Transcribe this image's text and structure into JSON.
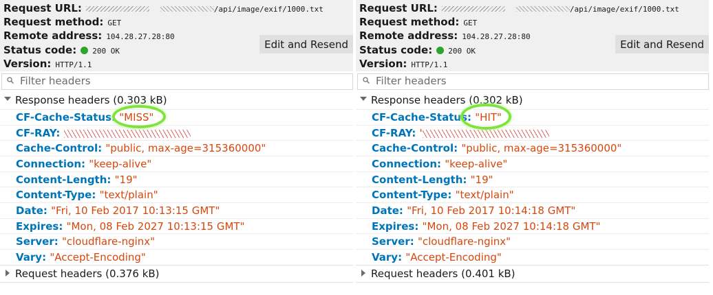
{
  "panels": [
    {
      "summary": {
        "url_label": "Request URL:",
        "url_value": "/api/image/exif/1000.txt",
        "method_label": "Request method:",
        "method_value": "GET",
        "remote_label": "Remote address:",
        "remote_value": "104.28.27.28:80",
        "status_label": "Status code:",
        "status_value": "200 OK",
        "version_label": "Version:",
        "version_value": "HTTP/1.1",
        "resend_label": "Edit and Resend"
      },
      "filter_placeholder": "Filter headers",
      "response_group": "Response headers (0.303 kB)",
      "headers": [
        {
          "name": "CF-Cache-Status",
          "value": "\"MISS\""
        },
        {
          "name": "CF-RAY",
          "value": ""
        },
        {
          "name": "Cache-Control",
          "value": "\"public, max-age=315360000\""
        },
        {
          "name": "Connection",
          "value": "\"keep-alive\""
        },
        {
          "name": "Content-Length",
          "value": "\"19\""
        },
        {
          "name": "Content-Type",
          "value": "\"text/plain\""
        },
        {
          "name": "Date",
          "value": "\"Fri, 10 Feb 2017 10:13:15 GMT\""
        },
        {
          "name": "Expires",
          "value": "\"Mon, 08 Feb 2027 10:13:15 GMT\""
        },
        {
          "name": "Server",
          "value": "\"cloudflare-nginx\""
        },
        {
          "name": "Vary",
          "value": "\"Accept-Encoding\""
        }
      ],
      "request_group": "Request headers (0.376 kB)"
    },
    {
      "summary": {
        "url_label": "Request URL:",
        "url_value": "/api/image/exif/1000.txt",
        "method_label": "Request method:",
        "method_value": "GET",
        "remote_label": "Remote address:",
        "remote_value": "104.28.27.28:80",
        "status_label": "Status code:",
        "status_value": "200 OK",
        "version_label": "Version:",
        "version_value": "HTTP/1.1",
        "resend_label": "Edit and Resend"
      },
      "filter_placeholder": "Filter headers",
      "response_group": "Response headers (0.302 kB)",
      "headers": [
        {
          "name": "CF-Cache-Status",
          "value": "\"HIT\""
        },
        {
          "name": "CF-RAY",
          "value": "'"
        },
        {
          "name": "Cache-Control",
          "value": "\"public, max-age=315360000\""
        },
        {
          "name": "Connection",
          "value": "\"keep-alive\""
        },
        {
          "name": "Content-Length",
          "value": "\"19\""
        },
        {
          "name": "Content-Type",
          "value": "\"text/plain\""
        },
        {
          "name": "Date",
          "value": "\"Fri, 10 Feb 2017 10:14:18 GMT\""
        },
        {
          "name": "Expires",
          "value": "\"Mon, 08 Feb 2027 10:14:18 GMT\""
        },
        {
          "name": "Server",
          "value": "\"cloudflare-nginx\""
        },
        {
          "name": "Vary",
          "value": "\"Accept-Encoding\""
        }
      ],
      "request_group": "Request headers (0.401 kB)"
    }
  ],
  "colors": {
    "header_name": "#0074b8",
    "header_value": "#d7470c",
    "status_ok": "#2ea32e",
    "highlight_circle": "#7ee33d"
  },
  "icons": [
    "search-icon",
    "status-dot-icon",
    "twisty-expanded-icon",
    "twisty-collapsed-icon"
  ]
}
